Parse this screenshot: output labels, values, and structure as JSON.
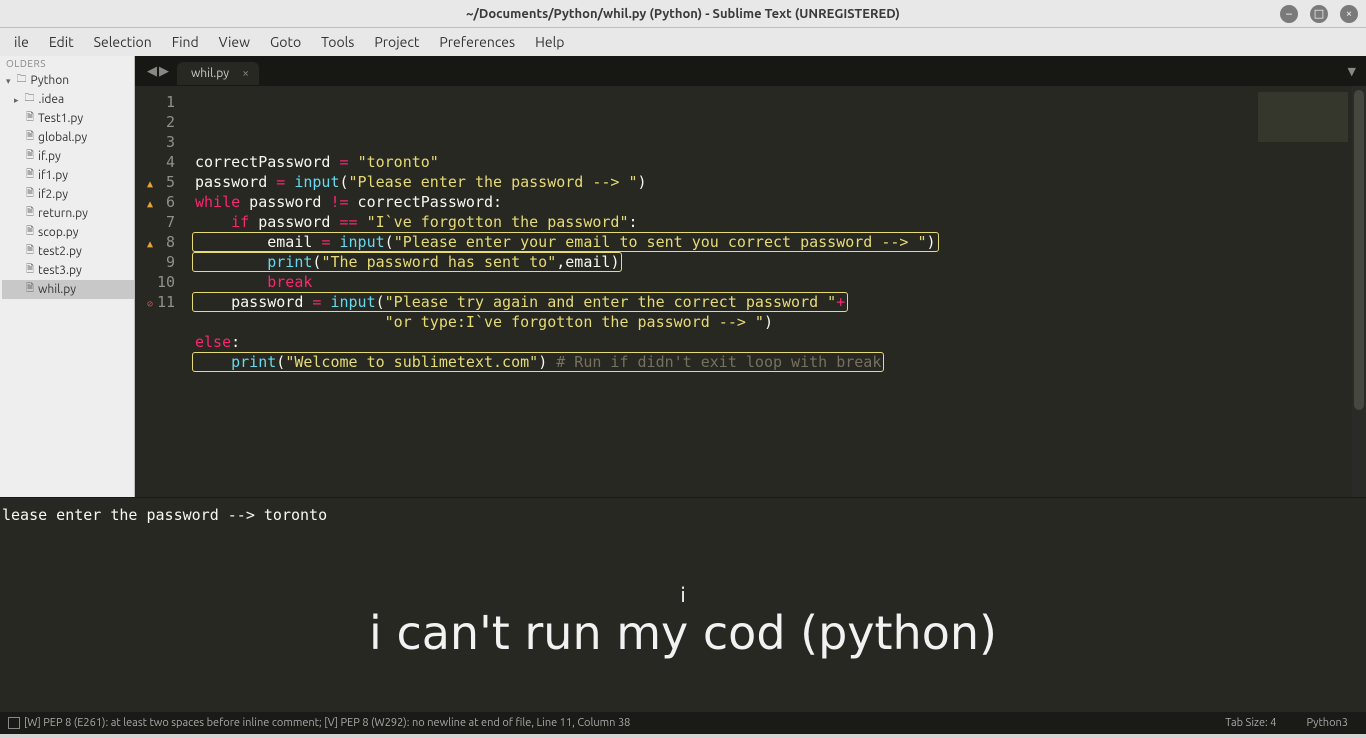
{
  "window": {
    "title": "~/Documents/Python/whil.py (Python) - Sublime Text (UNREGISTERED)"
  },
  "menu": [
    "ile",
    "Edit",
    "Selection",
    "Find",
    "View",
    "Goto",
    "Tools",
    "Project",
    "Preferences",
    "Help"
  ],
  "sidebar": {
    "header": "OLDERS",
    "items": [
      {
        "type": "folder-open",
        "label": "Python",
        "indent": 0
      },
      {
        "type": "folder",
        "label": ".idea",
        "indent": 1
      },
      {
        "type": "file",
        "label": "Test1.py",
        "indent": 2
      },
      {
        "type": "file",
        "label": "global.py",
        "indent": 2
      },
      {
        "type": "file",
        "label": "if.py",
        "indent": 2
      },
      {
        "type": "file",
        "label": "if1.py",
        "indent": 2
      },
      {
        "type": "file",
        "label": "if2.py",
        "indent": 2
      },
      {
        "type": "file",
        "label": "return.py",
        "indent": 2
      },
      {
        "type": "file",
        "label": "scop.py",
        "indent": 2
      },
      {
        "type": "file",
        "label": "test2.py",
        "indent": 2
      },
      {
        "type": "file",
        "label": "test3.py",
        "indent": 2
      },
      {
        "type": "file",
        "label": "whil.py",
        "indent": 2,
        "selected": true
      }
    ]
  },
  "tab": {
    "name": "whil.py"
  },
  "code": {
    "lines": [
      {
        "n": 1,
        "tokens": [
          [
            "nm",
            "correctPassword "
          ],
          [
            "op",
            "="
          ],
          [
            "nm",
            " "
          ],
          [
            "str",
            "\"toronto\""
          ]
        ]
      },
      {
        "n": 2,
        "tokens": [
          [
            "nm",
            "password "
          ],
          [
            "op",
            "="
          ],
          [
            "nm",
            " "
          ],
          [
            "fn",
            "input"
          ],
          [
            "pn",
            "("
          ],
          [
            "str",
            "\"Please enter the password --> \""
          ],
          [
            "pn",
            ")"
          ]
        ]
      },
      {
        "n": 3,
        "tokens": [
          [
            "kw",
            "while"
          ],
          [
            "nm",
            " password "
          ],
          [
            "op",
            "!="
          ],
          [
            "nm",
            " correctPassword"
          ],
          [
            "pn",
            ":"
          ]
        ]
      },
      {
        "n": 4,
        "tokens": [
          [
            "nm",
            "    "
          ],
          [
            "kw",
            "if"
          ],
          [
            "nm",
            " password "
          ],
          [
            "op",
            "=="
          ],
          [
            "nm",
            " "
          ],
          [
            "str",
            "\"I`ve forgotton the password\""
          ],
          [
            "pn",
            ":"
          ]
        ]
      },
      {
        "n": 5,
        "mark": "warn",
        "box": true,
        "tokens": [
          [
            "nm",
            "        email "
          ],
          [
            "op",
            "="
          ],
          [
            "nm",
            " "
          ],
          [
            "fn",
            "input"
          ],
          [
            "pn",
            "("
          ],
          [
            "str",
            "\"Please enter your email to sent you correct password --> \""
          ],
          [
            "pn",
            ")"
          ]
        ]
      },
      {
        "n": 6,
        "mark": "warn",
        "box": true,
        "tokens": [
          [
            "nm",
            "        "
          ],
          [
            "fn",
            "print"
          ],
          [
            "pn",
            "("
          ],
          [
            "str",
            "\"The password has sent to\""
          ],
          [
            "pn",
            ","
          ],
          [
            "nm",
            "email"
          ],
          [
            "pn",
            ")"
          ]
        ]
      },
      {
        "n": 7,
        "tokens": [
          [
            "nm",
            "        "
          ],
          [
            "kw",
            "break"
          ]
        ]
      },
      {
        "n": 8,
        "mark": "warn",
        "box": true,
        "tokens": [
          [
            "nm",
            "    password "
          ],
          [
            "op",
            "="
          ],
          [
            "nm",
            " "
          ],
          [
            "fn",
            "input"
          ],
          [
            "pn",
            "("
          ],
          [
            "str",
            "\"Please try again and enter the correct password \""
          ],
          [
            "op",
            "+"
          ]
        ]
      },
      {
        "n": 9,
        "tokens": [
          [
            "nm",
            "                     "
          ],
          [
            "str",
            "\"or type:I`ve forgotton the password --> \""
          ],
          [
            "pn",
            ")"
          ]
        ]
      },
      {
        "n": 10,
        "tokens": [
          [
            "kw",
            "else"
          ],
          [
            "pn",
            ":"
          ]
        ]
      },
      {
        "n": 11,
        "mark": "err",
        "box": true,
        "tokens": [
          [
            "nm",
            "    "
          ],
          [
            "fn",
            "print"
          ],
          [
            "pn",
            "("
          ],
          [
            "str",
            "\"Welcome to sublimetext.com\""
          ],
          [
            "pn",
            ") "
          ],
          [
            "cmt",
            "# Run if didn't exit loop with break"
          ]
        ]
      }
    ]
  },
  "console": {
    "output": "lease enter the password --> toronto",
    "overlay_small": "i",
    "overlay_big": "i can't run my cod (python)"
  },
  "status": {
    "left": "[W] PEP 8 (E261): at least two spaces before inline comment; [V] PEP 8 (W292): no newline at end of file, Line 11, Column 38",
    "tab_size": "Tab Size: 4",
    "syntax": "Python3"
  }
}
